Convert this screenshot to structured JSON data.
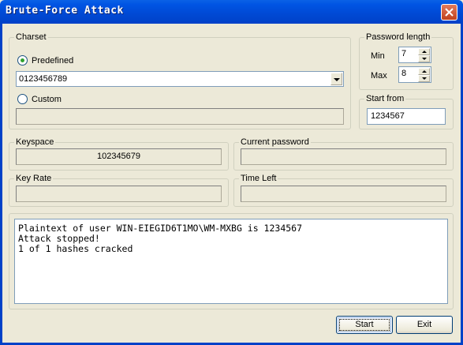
{
  "window": {
    "title": "Brute-Force Attack"
  },
  "charset": {
    "legend": "Charset",
    "predefined_label": "Predefined",
    "predefined_value": "0123456789",
    "custom_label": "Custom",
    "custom_value": "",
    "selected": "predefined"
  },
  "password_length": {
    "legend": "Password length",
    "min_label": "Min",
    "min_value": "7",
    "max_label": "Max",
    "max_value": "8"
  },
  "start_from": {
    "legend": "Start from",
    "value": "1234567"
  },
  "keyspace": {
    "legend": "Keyspace",
    "value": "102345679"
  },
  "current_password": {
    "legend": "Current password",
    "value": ""
  },
  "key_rate": {
    "legend": "Key Rate",
    "value": ""
  },
  "time_left": {
    "legend": "Time Left",
    "value": ""
  },
  "log": {
    "lines": [
      "Plaintext of user WIN-EIEGID6T1MO\\WM-MXBG is 1234567",
      "Attack stopped!",
      "1 of 1 hashes cracked"
    ]
  },
  "buttons": {
    "start": "Start",
    "exit": "Exit"
  }
}
